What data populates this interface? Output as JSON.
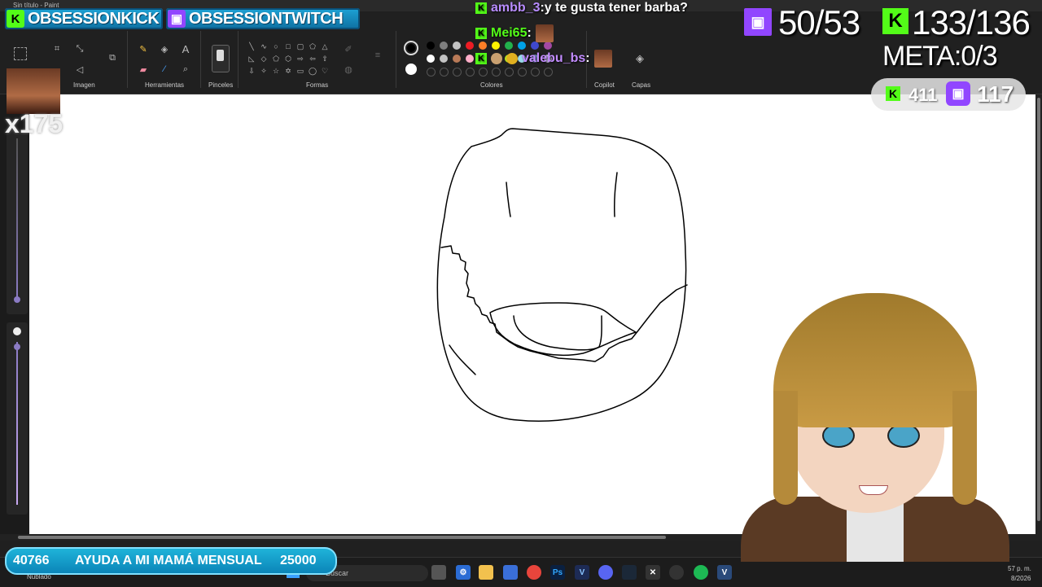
{
  "window": {
    "title": "Sin título - Paint"
  },
  "ribbon": {
    "groups": [
      "Imagen",
      "Herramientas",
      "Pinceles",
      "Formas",
      "Colores",
      "Copilot",
      "Capas"
    ]
  },
  "palette": {
    "primary": "#000000",
    "secondary": "#ffffff",
    "row1": [
      "#000000",
      "#7f7f7f",
      "#c3c3c3",
      "#ed1c24",
      "#ff7f27",
      "#fff200",
      "#22b14c",
      "#00a2e8",
      "#3f48cc",
      "#a349a4"
    ],
    "row2": [
      "#ffffff",
      "#c3c3c3",
      "#b97a57",
      "#ffaec9",
      "#ffc90e",
      "#efe4b0",
      "#b5e61d",
      "#99d9ea",
      "#7092be",
      "#c8bfe7"
    ]
  },
  "overlay": {
    "kick_banner": "OBSESSIONKICK",
    "twitch_banner": "OBSESSIONTWITCH",
    "chat": [
      {
        "user": "ambb_3",
        "sep": " : ",
        "message": "y te gusta tener barba?",
        "user_color": "#b88cff"
      },
      {
        "user": "Mei65",
        "sep": " : ",
        "message": "",
        "user_color": "#53fc18"
      },
      {
        "user": "valebu_bs",
        "sep": " : ",
        "message": "",
        "user_color": "#c28cff"
      }
    ],
    "twitch_count": "50/53",
    "kick_count": "133/136",
    "goal": "META:0/3",
    "kick_followers": "411",
    "twitch_followers": "117",
    "emote_counter": "x175",
    "donation": {
      "left": "40766",
      "label": "AYUDA A MI MAMÁ MENSUAL",
      "right": "25000"
    }
  },
  "taskbar": {
    "weather": "Nublado",
    "search_placeholder": "Buscar",
    "clock_time": "57 p. m.",
    "clock_date": "8/2026"
  },
  "colors": {
    "kick": "#53fc18",
    "twitch": "#9146ff",
    "banner": "#1ea3d6"
  }
}
